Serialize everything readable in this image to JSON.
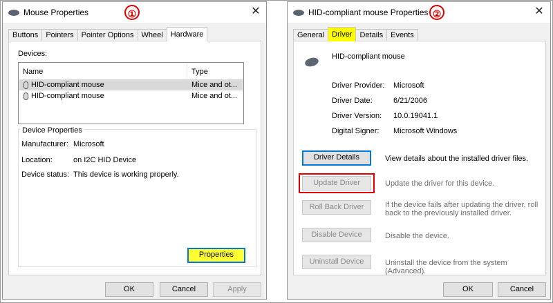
{
  "left_dialog": {
    "title": "Mouse Properties",
    "badge": "①",
    "tabs": [
      "Buttons",
      "Pointers",
      "Pointer Options",
      "Wheel",
      "Hardware"
    ],
    "devices_label": "Devices:",
    "columns": [
      "Name",
      "Type"
    ],
    "rows": [
      {
        "name": "HID-compliant mouse",
        "type": "Mice and ot...",
        "selected": true
      },
      {
        "name": "HID-compliant mouse",
        "type": "Mice and ot...",
        "selected": false
      }
    ],
    "device_properties": {
      "heading": "Device Properties",
      "manufacturer_label": "Manufacturer:",
      "manufacturer_value": "Microsoft",
      "location_label": "Location:",
      "location_value": "on I2C HID Device",
      "status_label": "Device status:",
      "status_value": "This device is working properly."
    },
    "properties_button": "Properties",
    "ok": "OK",
    "cancel": "Cancel",
    "apply": "Apply"
  },
  "right_dialog": {
    "title": "HID-compliant mouse Properties",
    "badge": "②",
    "tabs": [
      "General",
      "Driver",
      "Details",
      "Events"
    ],
    "device_name": "HID-compliant mouse",
    "info": {
      "provider_label": "Driver Provider:",
      "provider_value": "Microsoft",
      "date_label": "Driver Date:",
      "date_value": "6/21/2006",
      "version_label": "Driver Version:",
      "version_value": "10.0.19041.1",
      "signer_label": "Digital Signer:",
      "signer_value": "Microsoft Windows"
    },
    "buttons": {
      "details": "Driver Details",
      "update": "Update Driver",
      "rollback": "Roll Back Driver",
      "disable": "Disable Device",
      "uninstall": "Uninstall Device"
    },
    "descriptions": {
      "details": "View details about the installed driver files.",
      "update": "Update the driver for this device.",
      "rollback_1": "If the device fails after updating the driver, roll",
      "rollback_2": "back to the previously installed driver.",
      "disable": "Disable the device.",
      "uninstall": "Uninstall the device from the system (Advanced)."
    },
    "ok": "OK",
    "cancel": "Cancel"
  },
  "colors": {
    "accent": "#0078d7",
    "highlight": "#ffff00",
    "annotation": "#e00000"
  }
}
